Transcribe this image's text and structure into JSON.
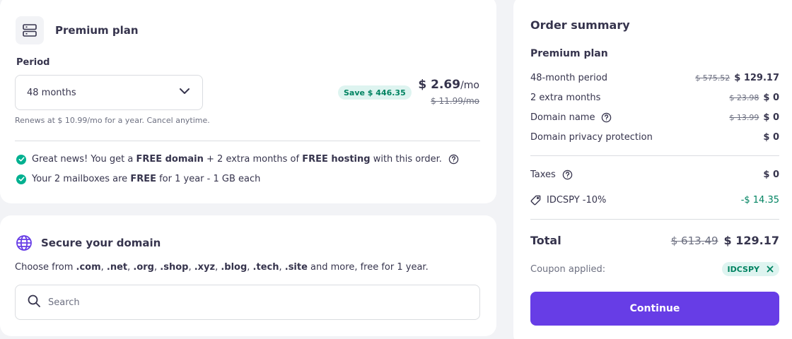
{
  "plan_card": {
    "title": "Premium plan",
    "period_label": "Period",
    "period_value": "48 months",
    "save_badge": "Save $ 446.35",
    "price": "$ 2.69",
    "price_unit": "/mo",
    "old_price": "$ 11.99/mo",
    "renew_note": "Renews at $ 10.99/mo for a year. Cancel anytime.",
    "perk1": {
      "t1": "Great news! You get a ",
      "b1": "FREE domain",
      "t2": " + 2 extra months of ",
      "b2": "FREE hosting",
      "t3": " with this order."
    },
    "perk2": {
      "t1": "Your 2 mailboxes are ",
      "b1": "FREE",
      "t2": " for 1 year - 1 GB each"
    }
  },
  "domain_card": {
    "title": "Secure your domain",
    "desc": {
      "t1": "Choose from ",
      "b1": ".com",
      "s1": ", ",
      "b2": ".net",
      "s2": ", ",
      "b3": ".org",
      "s3": ", ",
      "b4": ".shop",
      "s4": ", ",
      "b5": ".xyz",
      "s5": ", ",
      "b6": ".blog",
      "s6": ", ",
      "b7": ".tech",
      "s7": ", ",
      "b8": ".site",
      "t2": " and more, free for 1 year."
    },
    "search_placeholder": "Search"
  },
  "summary": {
    "title": "Order summary",
    "plan": "Premium plan",
    "rows": [
      {
        "label": "48-month period",
        "old": "$ 575.52",
        "amount": "$ 129.17"
      },
      {
        "label": "2 extra months",
        "old": "$ 23.98",
        "amount": "$ 0"
      },
      {
        "label": "Domain name",
        "old": "$ 13.99",
        "amount": "$ 0"
      },
      {
        "label": "Domain privacy protection",
        "amount": "$ 0"
      }
    ],
    "taxes_label": "Taxes",
    "taxes_amount": "$ 0",
    "coupon_label": "IDCSPY -10%",
    "coupon_amount": "-$ 14.35",
    "total_label": "Total",
    "total_old": "$ 613.49",
    "total_amount": "$ 129.17",
    "coupon_applied_label": "Coupon applied:",
    "coupon_code": "IDCSPY",
    "continue_label": "Continue"
  },
  "colors": {
    "accent": "#673de6",
    "success": "#00b090",
    "success_text": "#008361",
    "badge_bg": "#def4f0"
  },
  "icons": [
    "server-icon",
    "chevron-down-icon",
    "check-circle-icon",
    "help-circle-icon",
    "globe-icon",
    "search-icon",
    "tag-icon",
    "close-icon"
  ]
}
